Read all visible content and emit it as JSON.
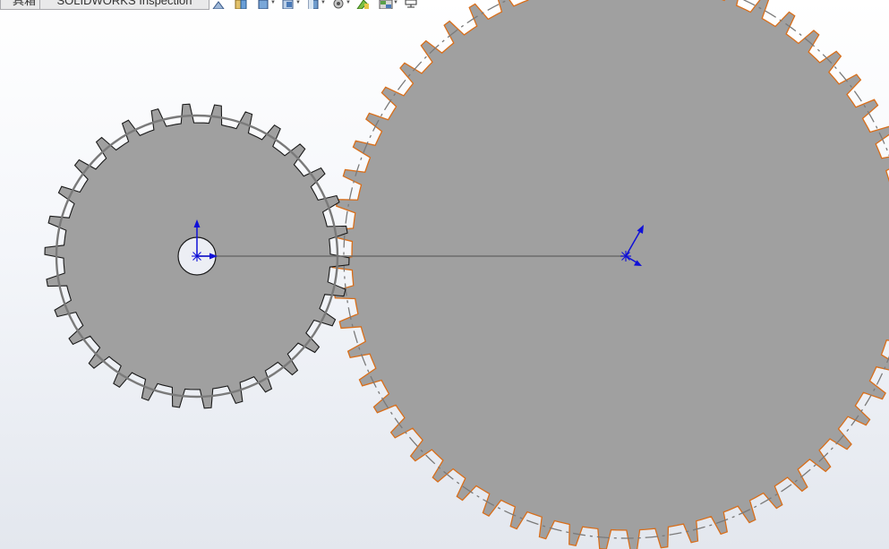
{
  "app": {
    "tabs": [
      {
        "label": "具箱"
      },
      {
        "label": "SOLIDWORKS Inspection"
      }
    ]
  },
  "toolbar": {
    "icons": [
      "view-orientation-icon",
      "section-view-icon",
      "display-style-icon",
      "hide-show-items-icon",
      "edit-appearance-icon",
      "apply-scene-icon",
      "view-settings-icon",
      "render-tools-icon",
      "display-monitor-icon"
    ]
  },
  "colors": {
    "gear_fill": "#a0a0a0",
    "small_gear_outline": "#1a1a1a",
    "large_gear_outline": "#d86e1a",
    "pitch_circle": "#7a7a7a",
    "center_line": "#6c6c6c",
    "axis_arrow": "#1010d8",
    "hole_fill": "#eceef4"
  },
  "scene": {
    "small_gear": {
      "teeth": 30
    },
    "large_gear": {
      "teeth": 60
    }
  }
}
